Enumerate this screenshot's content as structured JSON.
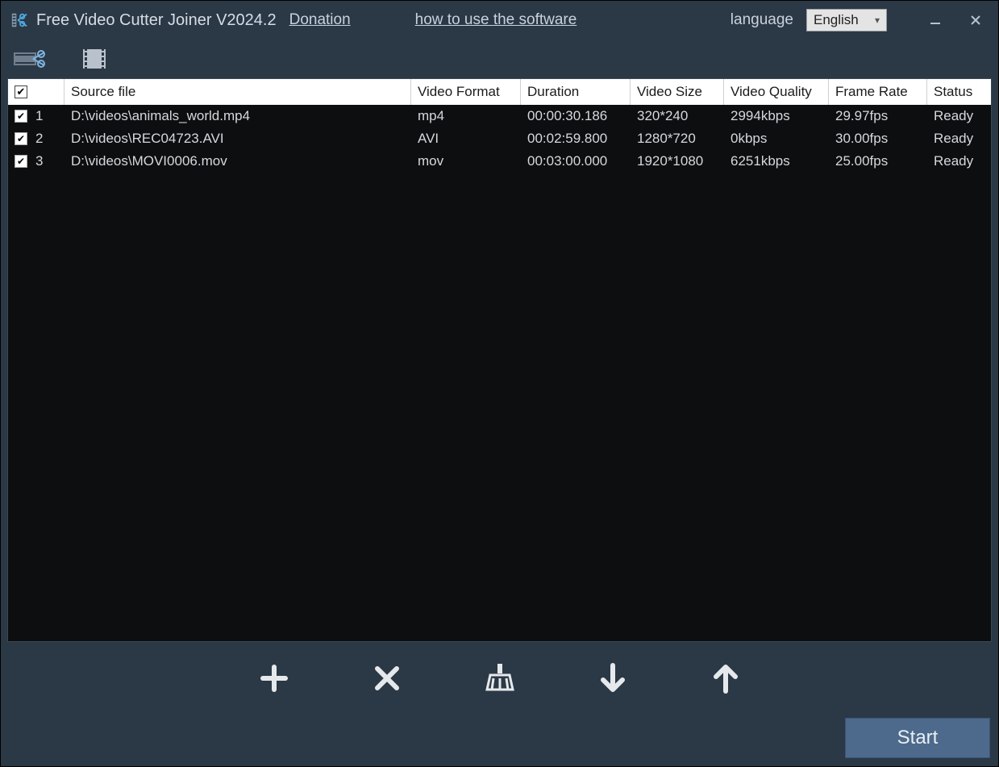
{
  "window": {
    "title": "Free Video Cutter Joiner V2024.2",
    "links": {
      "donation": "Donation",
      "howto": "how to use the software"
    },
    "language_label": "language",
    "language_value": "English"
  },
  "toolbar": {
    "mode_cut": "cut",
    "mode_join": "join"
  },
  "table": {
    "headers": {
      "source": "Source file",
      "format": "Video Format",
      "duration": "Duration",
      "size": "Video Size",
      "quality": "Video Quality",
      "fps": "Frame Rate",
      "status": "Status"
    },
    "rows": [
      {
        "index": "1",
        "checked": true,
        "source": "D:\\videos\\animals_world.mp4",
        "format": "mp4",
        "duration": "00:00:30.186",
        "size": "320*240",
        "quality": "2994kbps",
        "fps": "29.97fps",
        "status": "Ready"
      },
      {
        "index": "2",
        "checked": true,
        "source": "D:\\videos\\REC04723.AVI",
        "format": "AVI",
        "duration": "00:02:59.800",
        "size": "1280*720",
        "quality": "0kbps",
        "fps": "30.00fps",
        "status": "Ready"
      },
      {
        "index": "3",
        "checked": true,
        "source": "D:\\videos\\MOVI0006.mov",
        "format": "mov",
        "duration": "00:03:00.000",
        "size": "1920*1080",
        "quality": "6251kbps",
        "fps": "25.00fps",
        "status": "Ready"
      }
    ]
  },
  "actions": {
    "add": "Add",
    "remove": "Remove",
    "clear": "Clear",
    "down": "Move Down",
    "up": "Move Up",
    "start": "Start"
  }
}
